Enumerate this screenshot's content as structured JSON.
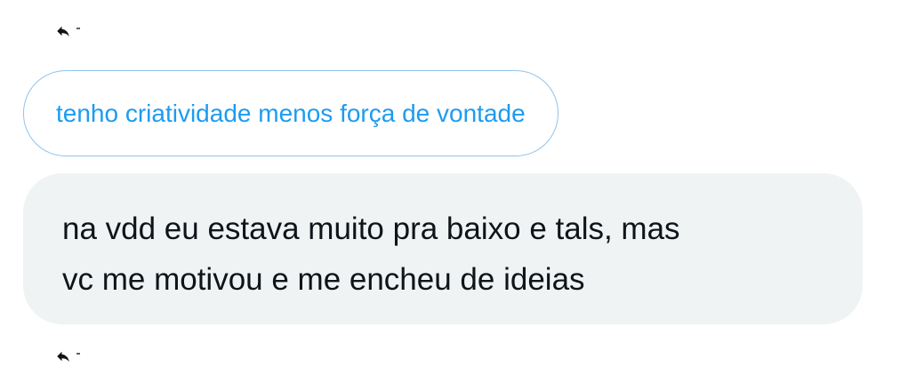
{
  "thread": {
    "top_reply": {
      "icon": "reply-icon"
    },
    "quoted_message": {
      "text": "tenho criatividade menos força de vontade"
    },
    "message": {
      "lines": [
        "na vdd eu estava muito pra baixo e tals, mas",
        "vc me motivou e me encheu de ideias"
      ]
    },
    "bottom_reply": {
      "icon": "reply-icon"
    }
  },
  "colors": {
    "quote_text": "#1d9bf0",
    "quote_border": "#8ec3ef",
    "bubble_bg": "#eff3f4",
    "text": "#0f1419",
    "icon": "#0f1419"
  }
}
